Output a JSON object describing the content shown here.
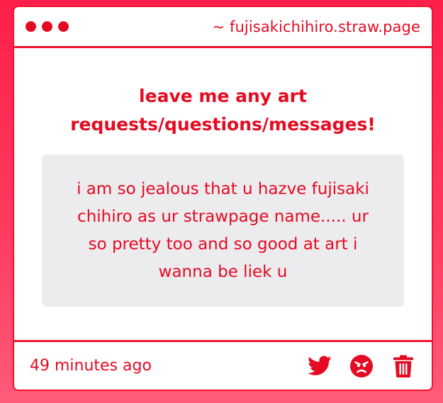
{
  "window": {
    "url": "~ fujisakichihiro.straw.page"
  },
  "content": {
    "title_line1": "leave me any art",
    "title_line2": "requests/questions/messages!",
    "message_lines": [
      "i am so jealous that u hazve fujisaki",
      "chihiro as ur strawpage name..... ur",
      "so pretty too and so good at art i",
      "wanna be liek u"
    ]
  },
  "footer": {
    "timestamp": "49 minutes ago",
    "icons": [
      "twitter-icon",
      "angry-face-icon",
      "trash-icon"
    ]
  },
  "colors": {
    "accent": "#e40b22",
    "background_gradient_top": "#ff1f4a",
    "background_gradient_bottom": "#ff5b7a",
    "message_bg": "#ecebed"
  }
}
